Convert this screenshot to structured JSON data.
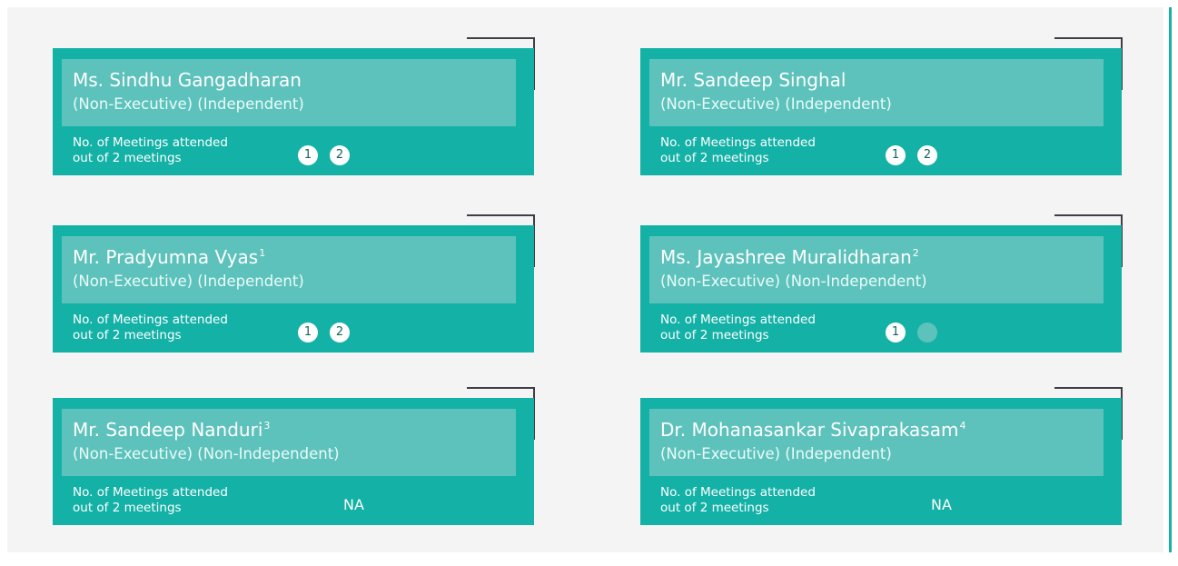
{
  "cards": [
    {
      "name": "Ms. Sindhu Gangadharan",
      "sup": "",
      "role": "(Non-Executive) (Independent)",
      "label_line1": "No. of Meetings attended",
      "label_line2": "out of 2 meetings",
      "dots": [
        "1",
        "2"
      ],
      "attended": [
        true,
        true
      ],
      "na": ""
    },
    {
      "name": "Mr. Sandeep Singhal",
      "sup": "",
      "role": "(Non-Executive) (Independent)",
      "label_line1": "No. of Meetings attended",
      "label_line2": "out of 2 meetings",
      "dots": [
        "1",
        "2"
      ],
      "attended": [
        true,
        true
      ],
      "na": ""
    },
    {
      "name": "Mr. Pradyumna Vyas",
      "sup": "1",
      "role": "(Non-Executive) (Independent)",
      "label_line1": "No. of Meetings attended",
      "label_line2": "out of 2 meetings",
      "dots": [
        "1",
        "2"
      ],
      "attended": [
        true,
        true
      ],
      "na": ""
    },
    {
      "name": "Ms. Jayashree Muralidharan",
      "sup": "2",
      "role": "(Non-Executive) (Non-Independent)",
      "label_line1": "No. of Meetings attended",
      "label_line2": "out of 2 meetings",
      "dots": [
        "1",
        ""
      ],
      "attended": [
        true,
        false
      ],
      "na": ""
    },
    {
      "name": "Mr. Sandeep Nanduri",
      "sup": "3",
      "role": "(Non-Executive) (Non-Independent)",
      "label_line1": "No. of Meetings attended",
      "label_line2": "out of 2 meetings",
      "dots": [],
      "attended": [],
      "na": "NA"
    },
    {
      "name": "Dr. Mohanasankar Sivaprakasam",
      "sup": "4",
      "role": "(Non-Executive) (Independent)",
      "label_line1": "No. of Meetings attended",
      "label_line2": "out of 2 meetings",
      "dots": [],
      "attended": [],
      "na": "NA"
    }
  ],
  "colors": {
    "card": "#14b1a6",
    "header": "#5ec2bc",
    "corner": "#3e3e44",
    "rule": "#14b1a6"
  }
}
